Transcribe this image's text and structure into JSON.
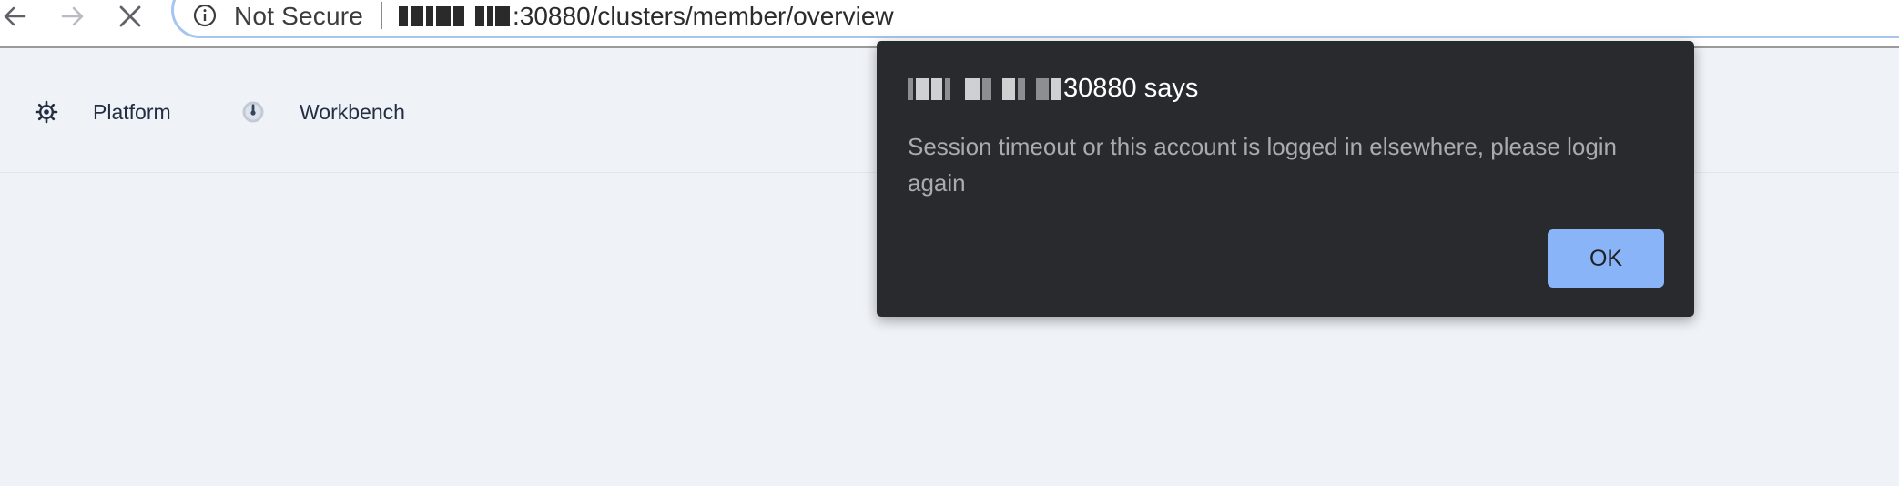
{
  "browser": {
    "security_label": "Not Secure",
    "url_visible": ":30880/clusters/member/overview"
  },
  "topnav": {
    "items": [
      {
        "label": "Platform",
        "icon": "gear-icon"
      },
      {
        "label": "Workbench",
        "icon": "gauge-icon"
      }
    ]
  },
  "dialog": {
    "title_suffix": "30880 says",
    "message": "Session timeout or this account is logged in elsewhere, please login again",
    "ok_label": "OK",
    "ok_color": "#8ab4f8",
    "background": "#292a2d"
  },
  "colors": {
    "page_background": "#eff3f8",
    "nav_text": "#242e42",
    "omnibox_border": "#a6c6ef"
  }
}
